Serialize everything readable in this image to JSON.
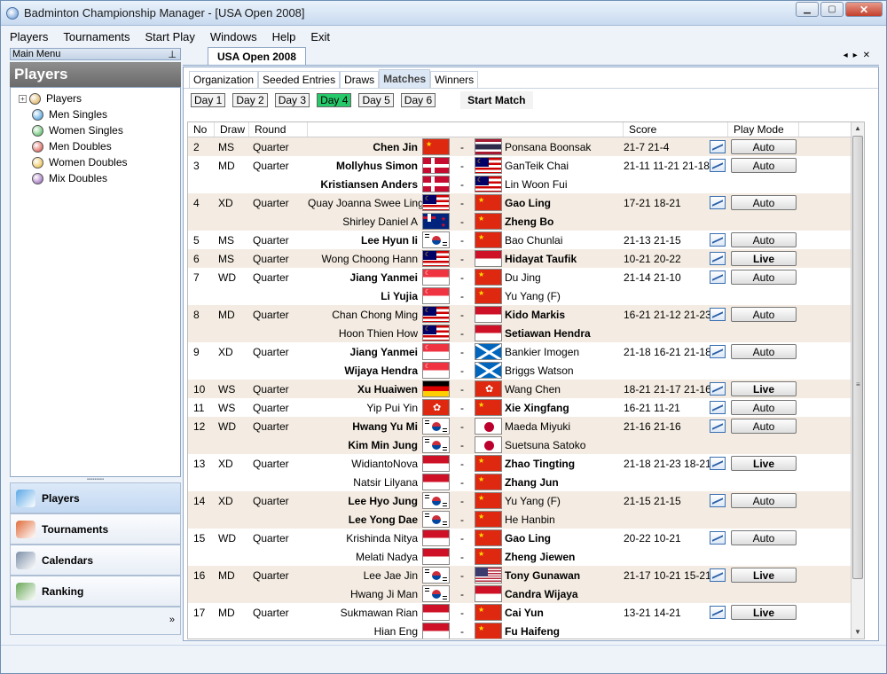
{
  "title": "Badminton Championship Manager - [USA Open 2008]",
  "menu": [
    "Players",
    "Tournaments",
    "Start Play",
    "Windows",
    "Help",
    "Exit"
  ],
  "left": {
    "header": "Main Menu",
    "panel_title": "Players",
    "tree": [
      {
        "label": "Players",
        "icon": "group-icon",
        "color": "#d9a441"
      },
      {
        "label": "Men Singles",
        "color": "#2a8fd8"
      },
      {
        "label": "Women Singles",
        "color": "#3bb34a"
      },
      {
        "label": "Men Doubles",
        "color": "#d63a2f"
      },
      {
        "label": "Women Doubles",
        "color": "#e6b52a"
      },
      {
        "label": "Mix Doubles",
        "color": "#8a4fb0"
      }
    ],
    "nav": [
      {
        "label": "Players",
        "icon": "players-icon",
        "active": true
      },
      {
        "label": "Tournaments",
        "icon": "tournaments-icon"
      },
      {
        "label": "Calendars",
        "icon": "calendar-icon"
      },
      {
        "label": "Ranking",
        "icon": "ranking-icon"
      }
    ]
  },
  "doc_tab": "USA Open 2008",
  "subtabs": [
    "Organization",
    "Seeded Entries",
    "Draws",
    "Matches",
    "Winners"
  ],
  "active_subtab": "Matches",
  "days": [
    "Day 1",
    "Day 2",
    "Day 3",
    "Day 4",
    "Day 5",
    "Day 6"
  ],
  "active_day": "Day 4",
  "start_match": "Start Match",
  "columns": [
    "No",
    "Draw",
    "Round",
    "Score",
    "Play Mode"
  ],
  "rows": [
    {
      "no": "2",
      "draw": "MS",
      "round": "Quarter",
      "p1": "Chen Jin",
      "p1b": true,
      "f1": "CHN",
      "p2": "Ponsana Boonsak",
      "p2b": false,
      "f2": "THA",
      "score": "21-7 21-4",
      "mode": "Auto",
      "shade": true
    },
    {
      "no": "3",
      "draw": "MD",
      "round": "Quarter",
      "p1": "Mollyhus Simon",
      "p1b": true,
      "f1": "DEN",
      "p2": "GanTeik Chai",
      "p2b": false,
      "f2": "MAS",
      "score": "21-11 11-21 21-18",
      "mode": "Auto",
      "shade": false
    },
    {
      "no": "",
      "draw": "",
      "round": "",
      "p1": "Kristiansen Anders",
      "p1b": true,
      "f1": "DEN",
      "p2": "Lin Woon Fui",
      "p2b": false,
      "f2": "MAS",
      "score": "",
      "mode": "",
      "shade": false
    },
    {
      "no": "4",
      "draw": "XD",
      "round": "Quarter",
      "p1": "Quay Joanna Swee Ling",
      "p1b": false,
      "f1": "MAS",
      "p2": "Gao Ling",
      "p2b": true,
      "f2": "CHN",
      "score": "17-21 18-21",
      "mode": "Auto",
      "shade": true
    },
    {
      "no": "",
      "draw": "",
      "round": "",
      "p1": "Shirley Daniel A",
      "p1b": false,
      "f1": "NZL",
      "p2": "Zheng Bo",
      "p2b": true,
      "f2": "CHN",
      "score": "",
      "mode": "",
      "shade": true
    },
    {
      "no": "5",
      "draw": "MS",
      "round": "Quarter",
      "p1": "Lee Hyun Ii",
      "p1b": true,
      "f1": "KOR",
      "p2": "Bao Chunlai",
      "p2b": false,
      "f2": "CHN",
      "score": "21-13 21-15",
      "mode": "Auto",
      "shade": false
    },
    {
      "no": "6",
      "draw": "MS",
      "round": "Quarter",
      "p1": "Wong Choong Hann",
      "p1b": false,
      "f1": "MAS",
      "p2": "Hidayat Taufik",
      "p2b": true,
      "f2": "INA",
      "score": "10-21 20-22",
      "mode": "Live",
      "shade": true
    },
    {
      "no": "7",
      "draw": "WD",
      "round": "Quarter",
      "p1": "Jiang Yanmei",
      "p1b": true,
      "f1": "SIN",
      "p2": "Du Jing",
      "p2b": false,
      "f2": "CHN",
      "score": "21-14 21-10",
      "mode": "Auto",
      "shade": false
    },
    {
      "no": "",
      "draw": "",
      "round": "",
      "p1": "Li Yujia",
      "p1b": true,
      "f1": "SIN",
      "p2": "Yu Yang (F)",
      "p2b": false,
      "f2": "CHN",
      "score": "",
      "mode": "",
      "shade": false
    },
    {
      "no": "8",
      "draw": "MD",
      "round": "Quarter",
      "p1": "Chan Chong Ming",
      "p1b": false,
      "f1": "MAS",
      "p2": "Kido Markis",
      "p2b": true,
      "f2": "INA",
      "score": "16-21 21-12 21-23",
      "mode": "Auto",
      "shade": true
    },
    {
      "no": "",
      "draw": "",
      "round": "",
      "p1": "Hoon Thien How",
      "p1b": false,
      "f1": "MAS",
      "p2": "Setiawan Hendra",
      "p2b": true,
      "f2": "INA",
      "score": "",
      "mode": "",
      "shade": true
    },
    {
      "no": "9",
      "draw": "XD",
      "round": "Quarter",
      "p1": "Jiang Yanmei",
      "p1b": true,
      "f1": "SIN",
      "p2": "Bankier Imogen",
      "p2b": false,
      "f2": "SCO",
      "score": "21-18 16-21 21-18",
      "mode": "Auto",
      "shade": false
    },
    {
      "no": "",
      "draw": "",
      "round": "",
      "p1": "Wijaya Hendra",
      "p1b": true,
      "f1": "SIN",
      "p2": "Briggs Watson",
      "p2b": false,
      "f2": "SCO",
      "score": "",
      "mode": "",
      "shade": false
    },
    {
      "no": "10",
      "draw": "WS",
      "round": "Quarter",
      "p1": "Xu Huaiwen",
      "p1b": true,
      "f1": "GER",
      "p2": "Wang Chen",
      "p2b": false,
      "f2": "HKG",
      "score": "18-21 21-17 21-16",
      "mode": "Live",
      "shade": true
    },
    {
      "no": "11",
      "draw": "WS",
      "round": "Quarter",
      "p1": "Yip Pui Yin",
      "p1b": false,
      "f1": "HKG",
      "p2": "Xie Xingfang",
      "p2b": true,
      "f2": "CHN",
      "score": "16-21 11-21",
      "mode": "Auto",
      "shade": false
    },
    {
      "no": "12",
      "draw": "WD",
      "round": "Quarter",
      "p1": "Hwang Yu Mi",
      "p1b": true,
      "f1": "KOR",
      "p2": "Maeda Miyuki",
      "p2b": false,
      "f2": "JPN",
      "score": "21-16 21-16",
      "mode": "Auto",
      "shade": true
    },
    {
      "no": "",
      "draw": "",
      "round": "",
      "p1": "Kim Min Jung",
      "p1b": true,
      "f1": "KOR",
      "p2": "Suetsuna Satoko",
      "p2b": false,
      "f2": "JPN",
      "score": "",
      "mode": "",
      "shade": true
    },
    {
      "no": "13",
      "draw": "XD",
      "round": "Quarter",
      "p1": "WidiantoNova",
      "p1b": false,
      "f1": "INA",
      "p2": "Zhao Tingting",
      "p2b": true,
      "f2": "CHN",
      "score": "21-18 21-23 18-21",
      "mode": "Live",
      "shade": false
    },
    {
      "no": "",
      "draw": "",
      "round": "",
      "p1": "Natsir Lilyana",
      "p1b": false,
      "f1": "INA",
      "p2": "Zhang Jun",
      "p2b": true,
      "f2": "CHN",
      "score": "",
      "mode": "",
      "shade": false
    },
    {
      "no": "14",
      "draw": "XD",
      "round": "Quarter",
      "p1": "Lee Hyo Jung",
      "p1b": true,
      "f1": "KOR",
      "p2": "Yu Yang (F)",
      "p2b": false,
      "f2": "CHN",
      "score": "21-15 21-15",
      "mode": "Auto",
      "shade": true
    },
    {
      "no": "",
      "draw": "",
      "round": "",
      "p1": "Lee Yong Dae",
      "p1b": true,
      "f1": "KOR",
      "p2": "He Hanbin",
      "p2b": false,
      "f2": "CHN",
      "score": "",
      "mode": "",
      "shade": true
    },
    {
      "no": "15",
      "draw": "WD",
      "round": "Quarter",
      "p1": "Krishinda Nitya",
      "p1b": false,
      "f1": "INA",
      "p2": "Gao Ling",
      "p2b": true,
      "f2": "CHN",
      "score": "20-22 10-21",
      "mode": "Auto",
      "shade": false
    },
    {
      "no": "",
      "draw": "",
      "round": "",
      "p1": "Melati Nadya",
      "p1b": false,
      "f1": "INA",
      "p2": "Zheng Jiewen",
      "p2b": true,
      "f2": "CHN",
      "score": "",
      "mode": "",
      "shade": false
    },
    {
      "no": "16",
      "draw": "MD",
      "round": "Quarter",
      "p1": "Lee Jae Jin",
      "p1b": false,
      "f1": "KOR",
      "p2": "Tony Gunawan",
      "p2b": true,
      "f2": "USA",
      "score": "21-17 10-21 15-21",
      "mode": "Live",
      "shade": true
    },
    {
      "no": "",
      "draw": "",
      "round": "",
      "p1": "Hwang Ji Man",
      "p1b": false,
      "f1": "KOR",
      "p2": "Candra Wijaya",
      "p2b": true,
      "f2": "INA",
      "score": "",
      "mode": "",
      "shade": true
    },
    {
      "no": "17",
      "draw": "MD",
      "round": "Quarter",
      "p1": "Sukmawan Rian",
      "p1b": false,
      "f1": "INA",
      "p2": "Cai Yun",
      "p2b": true,
      "f2": "CHN",
      "score": "13-21 14-21",
      "mode": "Live",
      "shade": false
    },
    {
      "no": "",
      "draw": "",
      "round": "",
      "p1": "Hian Eng",
      "p1b": false,
      "f1": "INA",
      "p2": "Fu Haifeng",
      "p2b": true,
      "f2": "CHN",
      "score": "",
      "mode": "",
      "shade": false
    }
  ]
}
